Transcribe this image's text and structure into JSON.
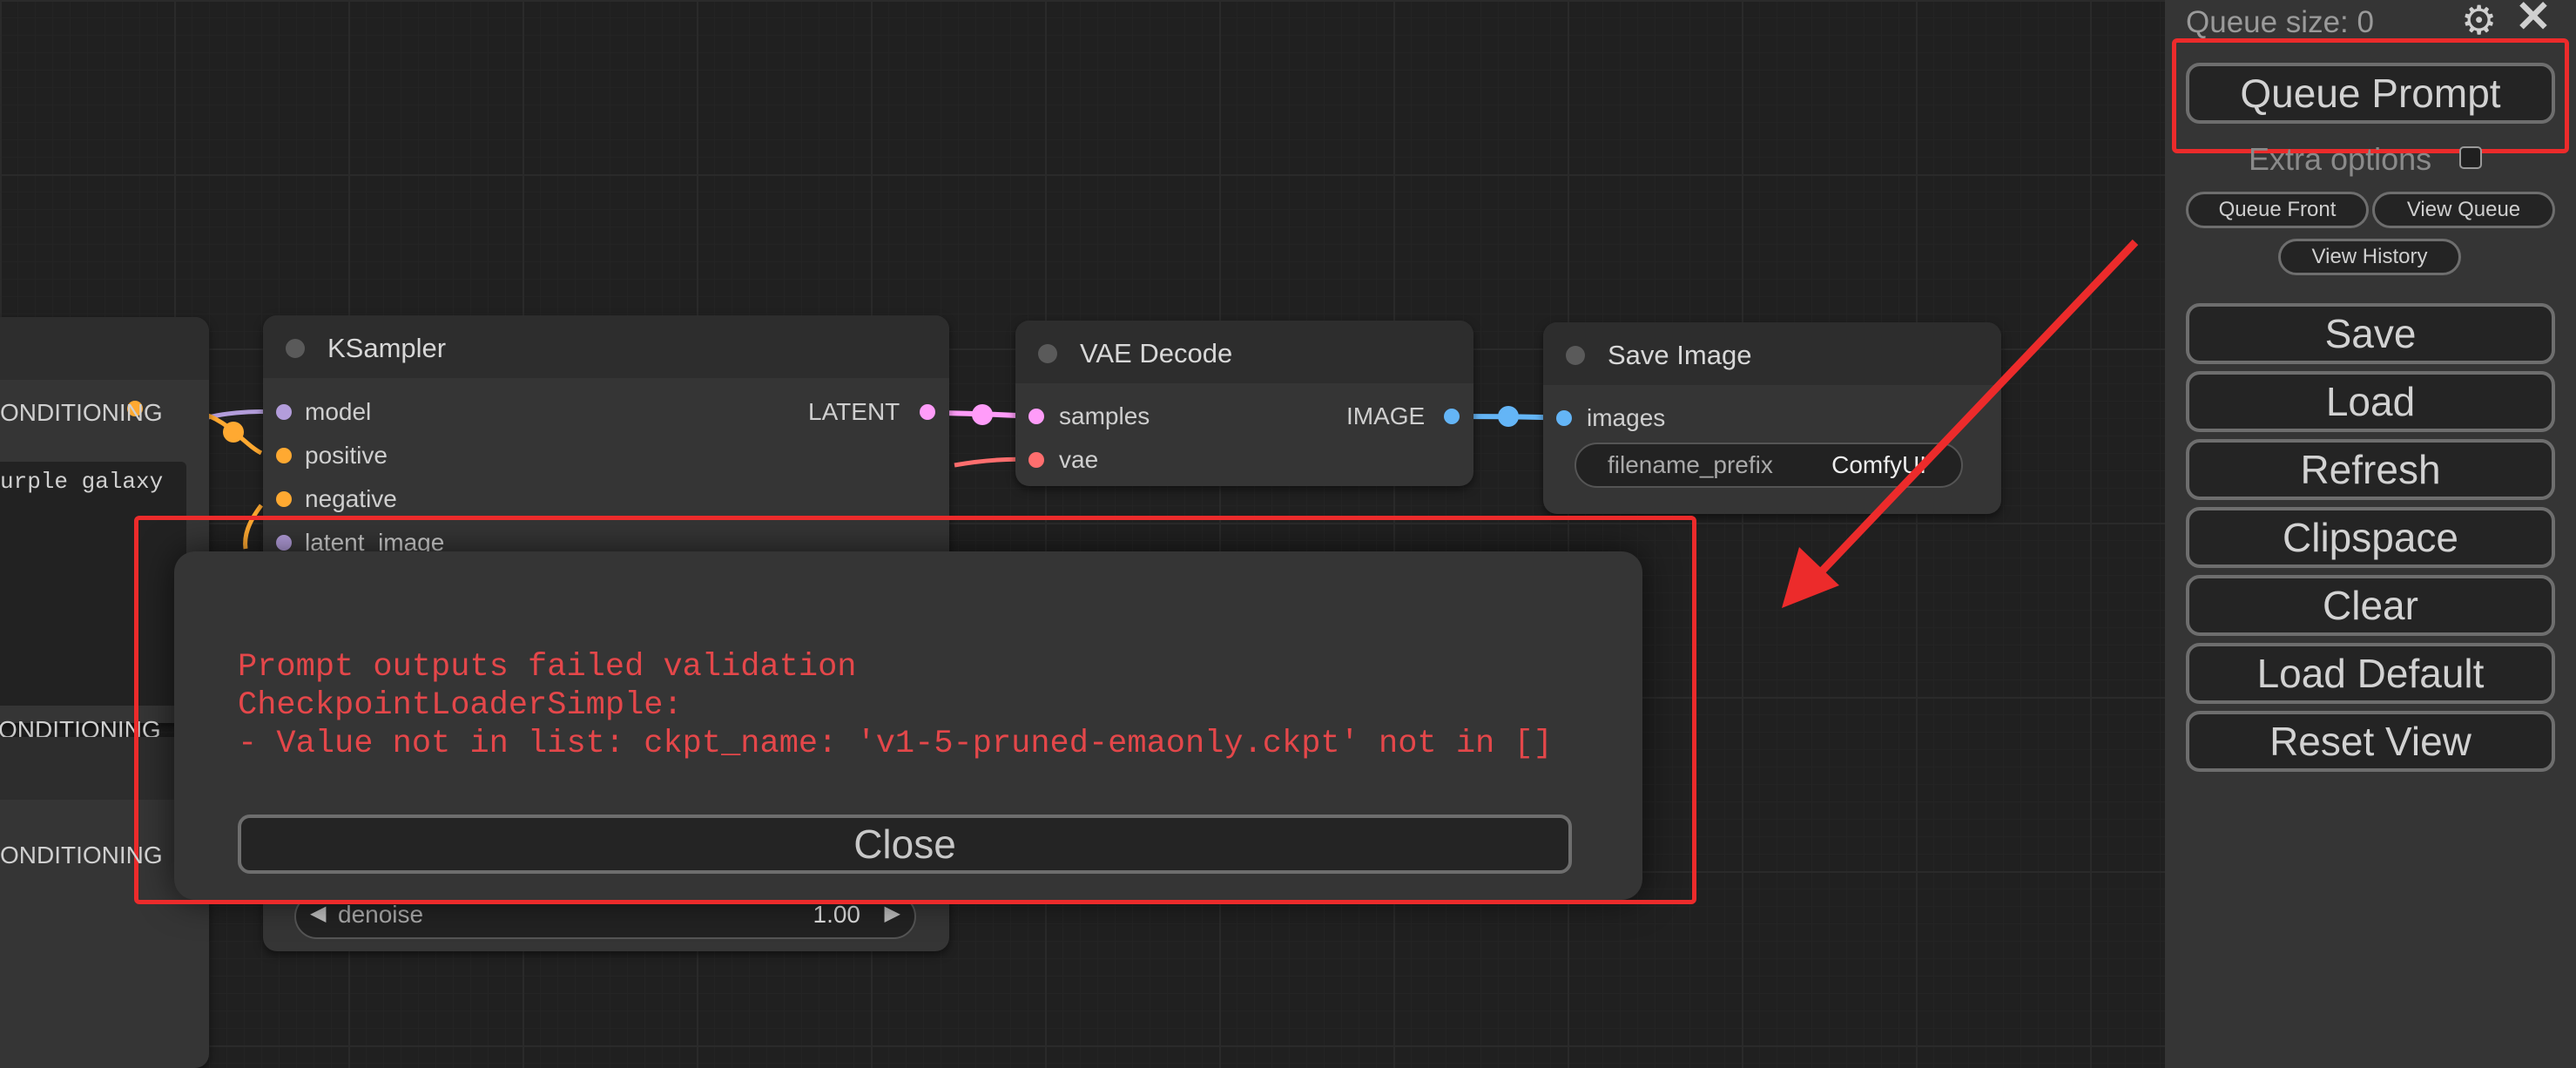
{
  "nodes": {
    "left_partial": {
      "output_label": "ONDITIONING",
      "text_snippet": "urple galaxy",
      "output_label_2": "ONDITIONING"
    },
    "ksampler": {
      "title": "KSampler",
      "inputs": [
        "model",
        "positive",
        "negative",
        "latent_image"
      ],
      "output": "LATENT",
      "denoise_label": "denoise",
      "denoise_value": "1.00"
    },
    "vae_decode": {
      "title": "VAE Decode",
      "inputs": [
        "samples",
        "vae"
      ],
      "output": "IMAGE"
    },
    "save_image": {
      "title": "Save Image",
      "input": "images",
      "widget_label": "filename_prefix",
      "widget_value": "ComfyUI"
    }
  },
  "dialog": {
    "lines": [
      "Prompt outputs failed validation",
      "CheckpointLoaderSimple:",
      "- Value not in list: ckpt_name: 'v1-5-pruned-emaonly.ckpt' not in []"
    ],
    "close_label": "Close"
  },
  "menu": {
    "queue_size": "Queue size: 0",
    "queue_prompt": "Queue Prompt",
    "extra_options": "Extra options",
    "queue_front": "Queue Front",
    "view_queue": "View Queue",
    "view_history": "View History",
    "buttons": [
      "Save",
      "Load",
      "Refresh",
      "Clipspace",
      "Clear",
      "Load Default",
      "Reset View"
    ]
  },
  "colors": {
    "highlight": "#ec2b2b",
    "error_text": "#e4474a",
    "model": "#b39ddb",
    "conditioning": "#ffa931",
    "latent": "#ff9cf9",
    "vae": "#ff6e6e",
    "image": "#64b5f6"
  }
}
